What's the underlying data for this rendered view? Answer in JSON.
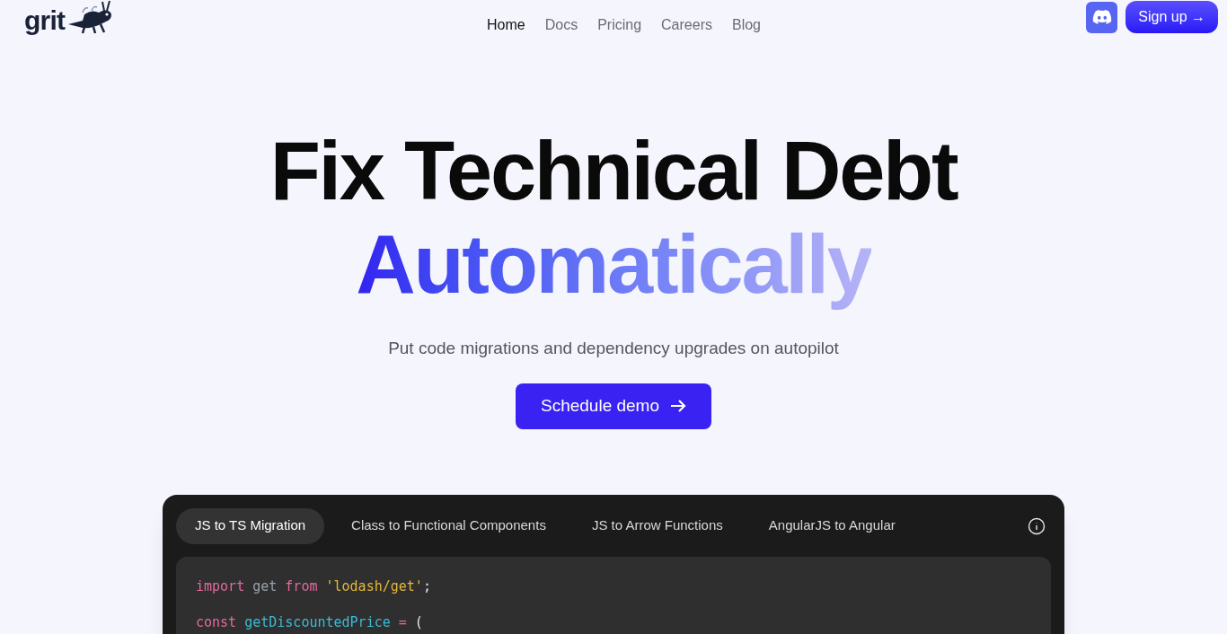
{
  "logo": {
    "text": "grit"
  },
  "nav": [
    {
      "label": "Home",
      "selected": true
    },
    {
      "label": "Docs",
      "selected": false
    },
    {
      "label": "Pricing",
      "selected": false
    },
    {
      "label": "Careers",
      "selected": false
    },
    {
      "label": "Blog",
      "selected": false
    }
  ],
  "signup": {
    "label": "Sign up",
    "arrow": "→"
  },
  "hero": {
    "title": "Fix Technical Debt",
    "highlight": "Automatically",
    "subtitle": "Put code migrations and dependency upgrades on autopilot",
    "cta": "Schedule demo"
  },
  "demo": {
    "tabs": [
      {
        "label": "JS to TS Migration",
        "selected": true
      },
      {
        "label": "Class to Functional Components",
        "selected": false
      },
      {
        "label": "JS to Arrow Functions",
        "selected": false
      },
      {
        "label": "AngularJS to Angular",
        "selected": false
      }
    ],
    "code": [
      [
        {
          "kind": "keyword",
          "text": "import"
        },
        {
          "kind": "ident",
          "text": " get "
        },
        {
          "kind": "keyword",
          "text": "from"
        },
        {
          "kind": "string",
          "text": " 'lodash/get'"
        },
        {
          "kind": "punct",
          "text": ";"
        }
      ],
      [
        {
          "kind": "keyword",
          "text": "const"
        },
        {
          "kind": "function",
          "text": " getDiscountedPrice"
        },
        {
          "kind": "keyword",
          "text": " ="
        },
        {
          "kind": "punct",
          "text": " ("
        }
      ]
    ]
  }
}
